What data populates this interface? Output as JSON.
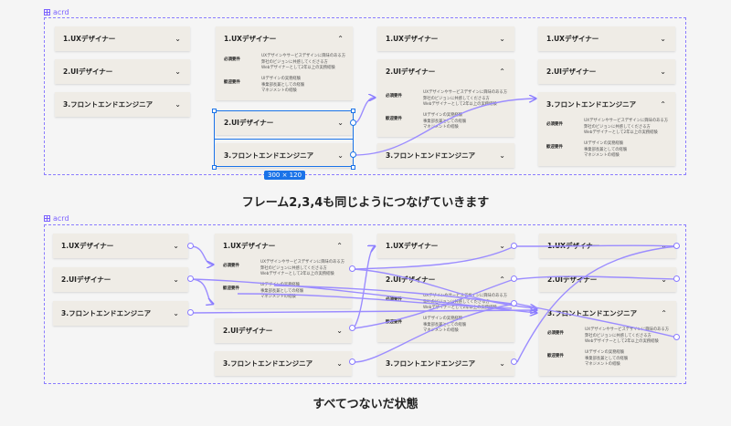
{
  "frame_label": "acrd",
  "items": {
    "ux": "1.UXデザイナー",
    "ui": "2.UIデザイナー",
    "fe": "3.フロントエンドエンジニア"
  },
  "detail": {
    "required_label": "必須要件",
    "required_lines": [
      "UXデザインやサービスデザインに興味のある方",
      "弊社のビジョンに共感してくださる方",
      "Webデザイナーとして2年以上の実務経験"
    ],
    "welcome_label": "歓迎要件",
    "welcome_lines": [
      "UIデザインの実務経験",
      "事業部長兼としての経験",
      "マネジメントの経験"
    ]
  },
  "selection_size": "300 × 120",
  "caption_1": "フレーム2,3,4も同じようにつなげていきます",
  "caption_2": "すべてつないだ状態",
  "accent_color": "#7b61ff",
  "selection_color": "#1a73e8",
  "icons": {
    "collapsed": "chevron-down-icon",
    "expanded": "chevron-up-icon",
    "frame": "frame-grid-icon"
  }
}
